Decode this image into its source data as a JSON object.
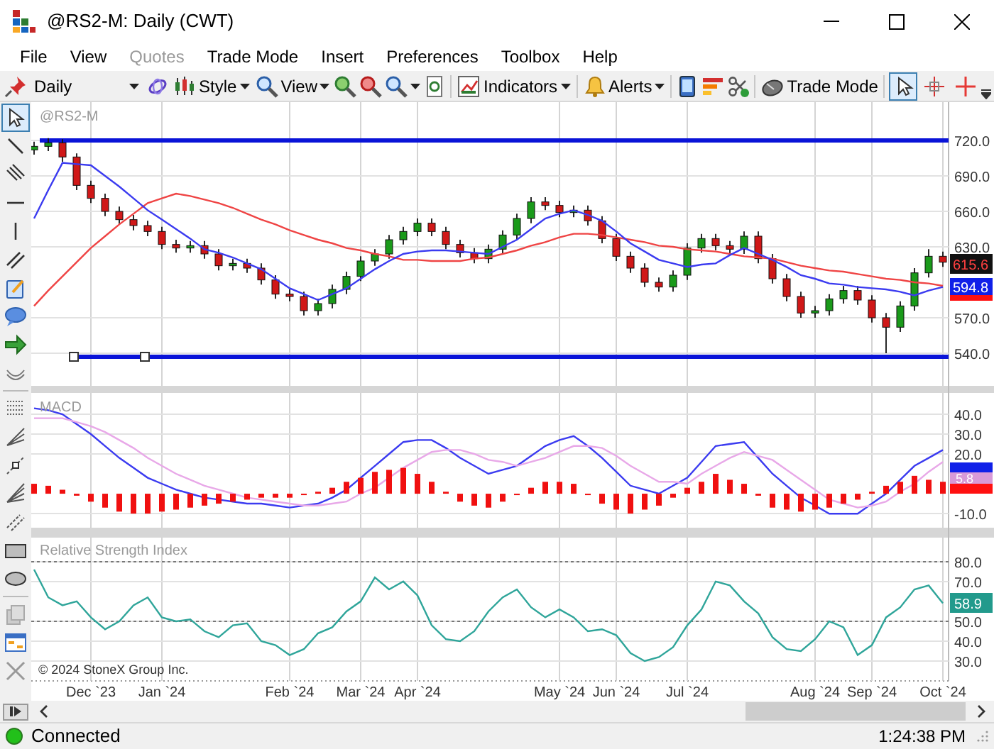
{
  "window": {
    "title": "@RS2-M: Daily (CWT)"
  },
  "menu": [
    {
      "label": "File",
      "disabled": false
    },
    {
      "label": "View",
      "disabled": false
    },
    {
      "label": "Quotes",
      "disabled": true
    },
    {
      "label": "Trade Mode",
      "disabled": false
    },
    {
      "label": "Insert",
      "disabled": false
    },
    {
      "label": "Preferences",
      "disabled": false
    },
    {
      "label": "Toolbox",
      "disabled": false
    },
    {
      "label": "Help",
      "disabled": false
    }
  ],
  "toolbar": {
    "period": "Daily",
    "style": "Style",
    "view": "View",
    "indicators": "Indicators",
    "alerts": "Alerts",
    "trade_mode": "Trade Mode",
    "cursor_modes": [
      {
        "selected": true
      },
      {
        "selected": false
      },
      {
        "selected": false
      }
    ]
  },
  "drawing_tools": [
    {
      "selected": true
    },
    {
      "selected": false
    },
    {
      "selected": false
    },
    {
      "selected": false
    },
    {
      "selected": false
    },
    {
      "selected": false
    },
    {
      "selected": false
    },
    {
      "selected": false
    },
    {
      "selected": false
    },
    {
      "selected": false
    },
    {
      "selected": false
    },
    {
      "selected": false
    },
    {
      "selected": false
    },
    {
      "selected": false
    },
    {
      "selected": false
    },
    {
      "selected": false
    },
    {
      "selected": false
    },
    {
      "selected": false
    },
    {
      "selected": false
    },
    {
      "selected": false
    }
  ],
  "price_panel": {
    "title": "@RS2-M",
    "last_price": "615.6",
    "average_value": "594.8",
    "chart_data": {
      "type": "candlestick",
      "grid": true,
      "categories": [
        null,
        null,
        null,
        null,
        null,
        null,
        null,
        null,
        null,
        null,
        null,
        null,
        null,
        null,
        null,
        null,
        null,
        null,
        null,
        null,
        null,
        null,
        null,
        null,
        null,
        null,
        null,
        null,
        null,
        null,
        null,
        null,
        null,
        null,
        null,
        null,
        null,
        null,
        null,
        null,
        null,
        null,
        null,
        null,
        null,
        null,
        null,
        null,
        null,
        null,
        null,
        null,
        null,
        null,
        null,
        null,
        null,
        null,
        null,
        null,
        null,
        null,
        null,
        null,
        null
      ],
      "ylim": [
        512.4,
        752.4
      ],
      "yticks": [
        {
          "value": 720,
          "label": "720.0"
        },
        {
          "value": 690,
          "label": "690.0"
        },
        {
          "value": 660,
          "label": "660.0"
        },
        {
          "value": 630,
          "label": "630.0"
        },
        {
          "value": 570,
          "label": "570.0"
        },
        {
          "value": 540,
          "label": "540.0"
        }
      ],
      "ohlc": [
        [
          712,
          719,
          708,
          715
        ],
        [
          715,
          722,
          711,
          718
        ],
        [
          718,
          721,
          702,
          706
        ],
        [
          706,
          709,
          678,
          682
        ],
        [
          682,
          686,
          667,
          671
        ],
        [
          671,
          675,
          656,
          660
        ],
        [
          660,
          664,
          649,
          653
        ],
        [
          653,
          657,
          644,
          648
        ],
        [
          648,
          652,
          639,
          643
        ],
        [
          643,
          647,
          628,
          632
        ],
        [
          632,
          636,
          625,
          629
        ],
        [
          629,
          635,
          625,
          631
        ],
        [
          631,
          635,
          620,
          624
        ],
        [
          624,
          628,
          610,
          614
        ],
        [
          614,
          620,
          610,
          616
        ],
        [
          616,
          620,
          608,
          612
        ],
        [
          612,
          616,
          598,
          602
        ],
        [
          602,
          606,
          586,
          590
        ],
        [
          590,
          594,
          584,
          588
        ],
        [
          588,
          592,
          572,
          576
        ],
        [
          576,
          586,
          572,
          582
        ],
        [
          582,
          598,
          578,
          594
        ],
        [
          594,
          609,
          590,
          605
        ],
        [
          605,
          622,
          601,
          618
        ],
        [
          618,
          628,
          614,
          624
        ],
        [
          624,
          640,
          620,
          636
        ],
        [
          636,
          647,
          632,
          643
        ],
        [
          643,
          654,
          639,
          650
        ],
        [
          650,
          654,
          639,
          643
        ],
        [
          643,
          647,
          628,
          632
        ],
        [
          632,
          636,
          621,
          625
        ],
        [
          625,
          629,
          616,
          620
        ],
        [
          620,
          632,
          616,
          628
        ],
        [
          628,
          644,
          624,
          640
        ],
        [
          640,
          658,
          636,
          654
        ],
        [
          654,
          672,
          650,
          668
        ],
        [
          668,
          672,
          661,
          665
        ],
        [
          665,
          669,
          655,
          659
        ],
        [
          659,
          665,
          655,
          661
        ],
        [
          661,
          665,
          648,
          652
        ],
        [
          652,
          656,
          633,
          637
        ],
        [
          637,
          641,
          618,
          622
        ],
        [
          622,
          626,
          608,
          612
        ],
        [
          612,
          616,
          596,
          600
        ],
        [
          600,
          604,
          592,
          596
        ],
        [
          596,
          610,
          592,
          606
        ],
        [
          606,
          633,
          602,
          629
        ],
        [
          629,
          641,
          625,
          637
        ],
        [
          637,
          641,
          627,
          631
        ],
        [
          631,
          635,
          624,
          628
        ],
        [
          628,
          643,
          624,
          639
        ],
        [
          639,
          643,
          616,
          620
        ],
        [
          620,
          624,
          599,
          603
        ],
        [
          603,
          607,
          584,
          588
        ],
        [
          588,
          592,
          570,
          574
        ],
        [
          574,
          580,
          570,
          576
        ],
        [
          576,
          590,
          572,
          586
        ],
        [
          586,
          597,
          582,
          593
        ],
        [
          593,
          597,
          581,
          585
        ],
        [
          585,
          589,
          566,
          570
        ],
        [
          570,
          574,
          540,
          562
        ],
        [
          562,
          584,
          558,
          580
        ],
        [
          580,
          612,
          576,
          608
        ],
        [
          608,
          628,
          604,
          622
        ],
        [
          622,
          626,
          613,
          617
        ]
      ],
      "series": [
        {
          "type": "line",
          "color": "#3b3bf0",
          "values": [
            654,
            678,
            701,
            700,
            699,
            690,
            681,
            671,
            661,
            653,
            645,
            637,
            628,
            625,
            621,
            616,
            611,
            603,
            595,
            590,
            585,
            590,
            595,
            603,
            611,
            618,
            624,
            626,
            627,
            627,
            626,
            625,
            624,
            630,
            636,
            645,
            654,
            658,
            661,
            657,
            652,
            643,
            633,
            626,
            619,
            616,
            613,
            615,
            616,
            623,
            629,
            624,
            619,
            613,
            606,
            603,
            599,
            598,
            596,
            595,
            594,
            592,
            589,
            593,
            596
          ]
        },
        {
          "type": "line",
          "color": "#ef4444",
          "values": [
            580,
            593,
            605,
            617,
            629,
            639,
            649,
            658,
            667,
            671,
            675,
            673,
            670,
            667,
            663,
            658,
            653,
            649,
            644,
            640,
            636,
            633,
            629,
            627,
            624,
            622,
            619,
            619,
            618,
            618,
            618,
            620,
            621,
            624,
            627,
            631,
            634,
            638,
            641,
            641,
            640,
            638,
            636,
            634,
            631,
            630,
            628,
            627,
            626,
            624,
            622,
            621,
            620,
            617,
            614,
            612,
            610,
            609,
            607,
            605,
            603,
            602,
            600,
            599,
            597
          ]
        }
      ],
      "ref_lines": [
        {
          "axis": "y",
          "value": 720
        },
        {
          "axis": "y",
          "value": 537
        }
      ]
    }
  },
  "macd_panel": {
    "title": "MACD",
    "signal_value": "5.8",
    "chart_data": {
      "type": "line",
      "grid": true,
      "categories": [
        null,
        null,
        null,
        null,
        null,
        null,
        null,
        null,
        null,
        null,
        null,
        null,
        null,
        null,
        null,
        null,
        null,
        null,
        null,
        null,
        null,
        null,
        null,
        null,
        null,
        null,
        null,
        null,
        null,
        null,
        null,
        null,
        null,
        null,
        null,
        null,
        null,
        null,
        null,
        null,
        null,
        null,
        null,
        null,
        null,
        null,
        null,
        null,
        null,
        null,
        null,
        null,
        null,
        null,
        null,
        null,
        null,
        null,
        null,
        null,
        null,
        null,
        null,
        null,
        null
      ],
      "ylim": [
        -17.1,
        50.7
      ],
      "yticks": [
        {
          "value": 40,
          "label": "40.0"
        },
        {
          "value": 30,
          "label": "30.0"
        },
        {
          "value": 20,
          "label": "20.0"
        },
        {
          "value": -10,
          "label": "-10.0"
        }
      ],
      "series": [
        {
          "type": "bar",
          "color": "#f01010",
          "values": [
            5,
            4,
            2,
            -1,
            -4,
            -7,
            -9,
            -10,
            -10,
            -9,
            -8,
            -7,
            -6,
            -5,
            -4,
            -3,
            -2,
            -2,
            -2,
            0,
            1,
            3,
            6,
            8,
            11,
            12,
            13,
            10,
            6,
            1,
            -4,
            -6,
            -7,
            -4,
            0,
            3,
            6,
            6,
            5,
            0,
            -5,
            -8,
            -10,
            -8,
            -6,
            -2,
            3,
            6,
            10,
            7,
            5,
            -1,
            -7,
            -8,
            -9,
            -8,
            -7,
            -5,
            -3,
            1,
            4,
            6,
            9,
            7,
            6
          ]
        },
        {
          "type": "line",
          "color": "#e8a8e8",
          "values": [
            38,
            38,
            38,
            36,
            34,
            31,
            27,
            23,
            18,
            14,
            10,
            7,
            4,
            2,
            0,
            -2,
            -3,
            -4,
            -5,
            -6,
            -6,
            -5,
            -4,
            0,
            3,
            8,
            13,
            17,
            21,
            22,
            22,
            20,
            17,
            16,
            14,
            16,
            18,
            21,
            24,
            24,
            23,
            19,
            14,
            10,
            6,
            6,
            5,
            10,
            14,
            18,
            21,
            19,
            17,
            12,
            7,
            2,
            -3,
            -5,
            -7,
            -6,
            -4,
            1,
            5,
            11,
            16
          ]
        },
        {
          "type": "line",
          "color": "#3b3bf0",
          "values": [
            43,
            42,
            40,
            35,
            30,
            24,
            18,
            13,
            8,
            5,
            2,
            0,
            -2,
            -3,
            -4,
            -5,
            -5,
            -6,
            -7,
            -6,
            -5,
            -2,
            2,
            8,
            14,
            20,
            26,
            27,
            27,
            23,
            18,
            14,
            10,
            12,
            14,
            19,
            24,
            27,
            29,
            24,
            18,
            11,
            4,
            2,
            0,
            4,
            8,
            16,
            24,
            25,
            26,
            18,
            10,
            4,
            -2,
            -6,
            -10,
            -10,
            -10,
            -5,
            0,
            7,
            14,
            18,
            22
          ]
        }
      ]
    }
  },
  "rsi_panel": {
    "title": "Relative Strength Index",
    "value": "58.9",
    "copyright": "© 2024 StoneX Group Inc.",
    "chart_data": {
      "type": "line",
      "grid": true,
      "categories": [
        null,
        null,
        null,
        null,
        "Dec `23",
        null,
        null,
        null,
        null,
        "Jan `24",
        null,
        null,
        null,
        null,
        null,
        null,
        null,
        null,
        "Feb `24",
        null,
        null,
        null,
        null,
        "Mar `24",
        null,
        null,
        null,
        "Apr `24",
        null,
        null,
        null,
        null,
        null,
        null,
        null,
        null,
        null,
        "May `24",
        null,
        null,
        null,
        "Jun `24",
        null,
        null,
        null,
        null,
        "Jul `24",
        null,
        null,
        null,
        null,
        null,
        null,
        null,
        null,
        "Aug `24",
        null,
        null,
        null,
        "Sep `24",
        null,
        null,
        null,
        null,
        "Oct `24"
      ],
      "ylim": [
        21.4,
        92.1
      ],
      "yticks": [
        {
          "value": 80,
          "label": "80.0"
        },
        {
          "value": 70,
          "label": "70.0"
        },
        {
          "value": 50,
          "label": "50.0"
        },
        {
          "value": 40,
          "label": "40.0"
        },
        {
          "value": 30,
          "label": "30.0"
        }
      ],
      "series": [
        {
          "type": "line",
          "color": "#2fa59a",
          "values": [
            76,
            62,
            58,
            60,
            52,
            46,
            50,
            58,
            62,
            52,
            50,
            51,
            45,
            42,
            48,
            49,
            40,
            38,
            33,
            36,
            44,
            47,
            55,
            60,
            72,
            66,
            70,
            63,
            48,
            41,
            40,
            45,
            55,
            62,
            66,
            57,
            52,
            56,
            52,
            45,
            46,
            43,
            34,
            30,
            32,
            37,
            48,
            56,
            70,
            68,
            60,
            54,
            42,
            36,
            35,
            41,
            50,
            47,
            33,
            38,
            52,
            57,
            66,
            68,
            59
          ]
        }
      ]
    }
  },
  "status_bar": {
    "connection": "Connected",
    "connected": true,
    "time": "1:24:38 PM"
  }
}
